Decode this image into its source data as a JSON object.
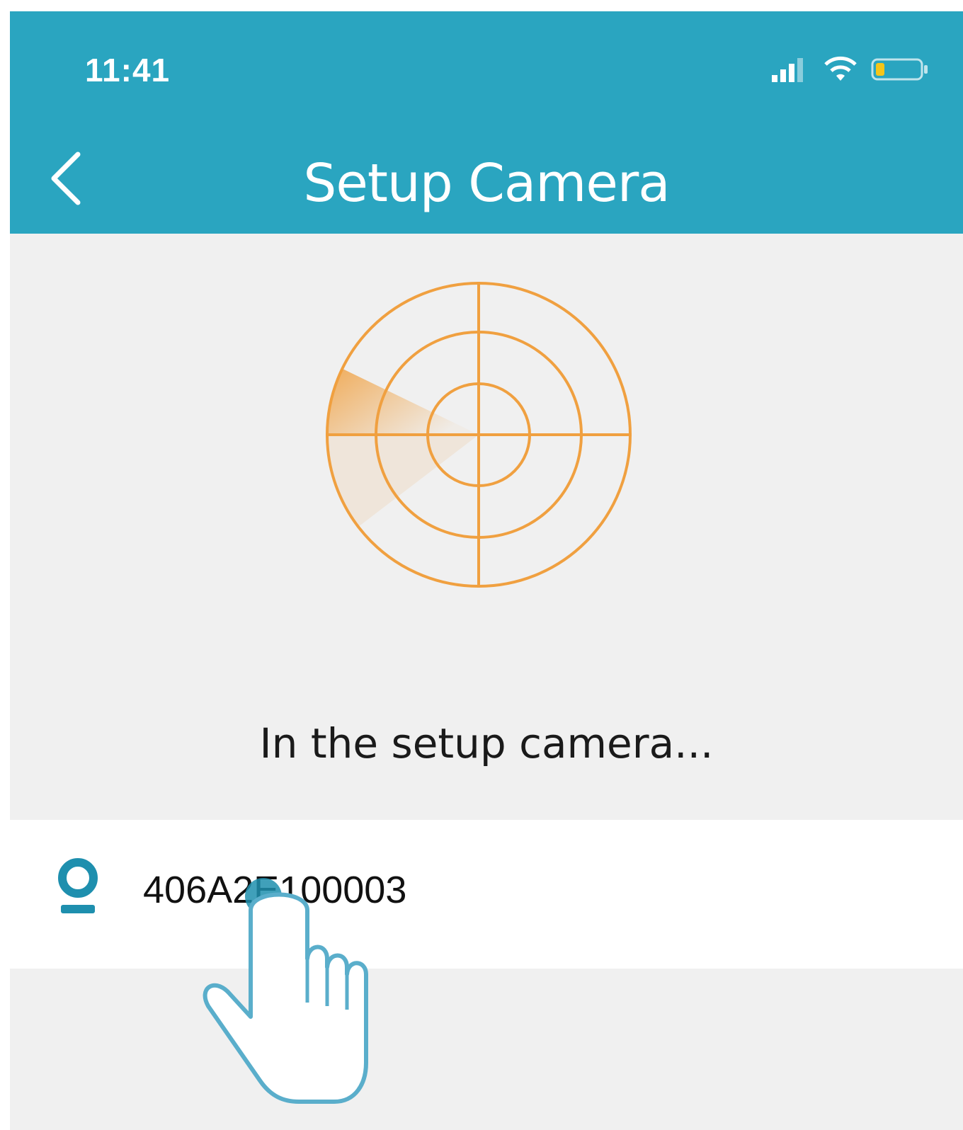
{
  "status_bar": {
    "time": "11:41"
  },
  "header": {
    "title": "Setup Camera"
  },
  "main": {
    "status_message": "In the setup camera..."
  },
  "device_list": {
    "items": [
      {
        "name": "406A2E100003",
        "icon": "camera-icon"
      }
    ]
  },
  "colors": {
    "header_bg": "#2aa5c0",
    "radar": "#f0a040",
    "device_icon": "#1e8fae"
  }
}
